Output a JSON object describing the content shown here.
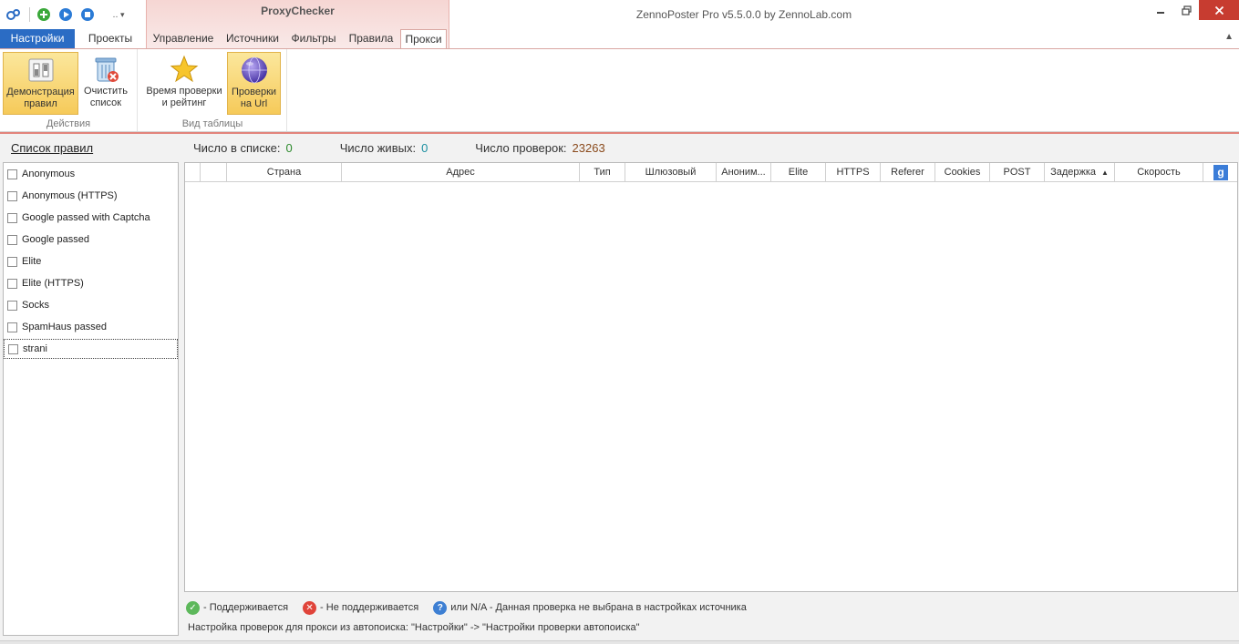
{
  "app": {
    "title": "ZennoPoster Pro v5.5.0.0 by ZennoLab.com",
    "context_title": "ProxyChecker"
  },
  "quick_access": {
    "icons": [
      "app-logo-icon",
      "add-icon",
      "play-icon",
      "stop-icon",
      "customize-icon"
    ]
  },
  "tabs": {
    "file": "Настройки",
    "projects": "Проекты",
    "management": "Управление",
    "sources": "Источники",
    "filters": "Фильтры",
    "rules": "Правила",
    "proxy": "Прокси"
  },
  "ribbon": {
    "group_actions": "Действия",
    "group_view": "Вид таблицы",
    "demo_rules": "Демонстрация\nправил",
    "clear_list": "Очистить\nсписок",
    "time_rating": "Время проверки\nи рейтинг",
    "url_checks": "Проверки\nна Url"
  },
  "stats": {
    "list_label": "Число в списке:",
    "list_value": "0",
    "alive_label": "Число живых:",
    "alive_value": "0",
    "checks_label": "Число проверок:",
    "checks_value": "23263"
  },
  "rules_panel": {
    "title": "Список правил",
    "items": [
      "Anonymous",
      "Anonymous (HTTPS)",
      "Google passed with Captcha",
      "Google passed",
      "Elite",
      "Elite (HTTPS)",
      "Socks",
      "SpamHaus passed",
      "strani"
    ]
  },
  "grid": {
    "columns": [
      "",
      "",
      "Страна",
      "Адрес",
      "Тип",
      "Шлюзовый",
      "Аноним...",
      "Elite",
      "HTTPS",
      "Referer",
      "Cookies",
      "POST",
      "Задержка",
      "Скорость"
    ],
    "sort_arrow": "▲",
    "google_button": "g"
  },
  "legend": {
    "supported": "- Поддерживается",
    "not_supported": "- Не поддерживается",
    "na": "или N/A - Данная проверка не выбрана в настройках источника",
    "hint": "Настройка проверок для прокси из автопоиска: \"Настройки\" -> \"Настройки проверки автопоиска\""
  },
  "colors": {
    "file_tab": "#2b6cc4",
    "context_tab": "#f6d6d3",
    "ribbon_accent": "#e2847c",
    "active_button": "#f6ca5a",
    "close_button": "#c73c30"
  }
}
